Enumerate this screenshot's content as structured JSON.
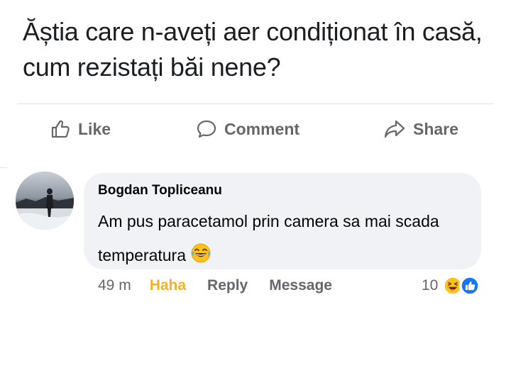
{
  "post": {
    "text": "Ăștia care n-aveți aer condiționat în casă, cum rezistați băi nene?"
  },
  "actions": {
    "like_label": "Like",
    "comment_label": "Comment",
    "share_label": "Share",
    "like_icon": "thumbs-up-icon",
    "comment_icon": "speech-bubble-icon",
    "share_icon": "share-arrow-icon"
  },
  "comment": {
    "author": "Bogdan Topliceanu",
    "text": "Am pus paracetamol prin camera sa mai scada temperatura",
    "emoji": "laughing-tears-emoji",
    "time": "49 m",
    "haha_label": "Haha",
    "reply_label": "Reply",
    "message_label": "Message",
    "reaction_count": "10",
    "reaction_icons": [
      "haha-reaction-icon",
      "like-reaction-icon"
    ]
  },
  "colors": {
    "secondary_text": "#65676b",
    "bubble_bg": "#f0f2f5",
    "haha_color": "#f7b125",
    "like_blue": "#1877f2"
  }
}
